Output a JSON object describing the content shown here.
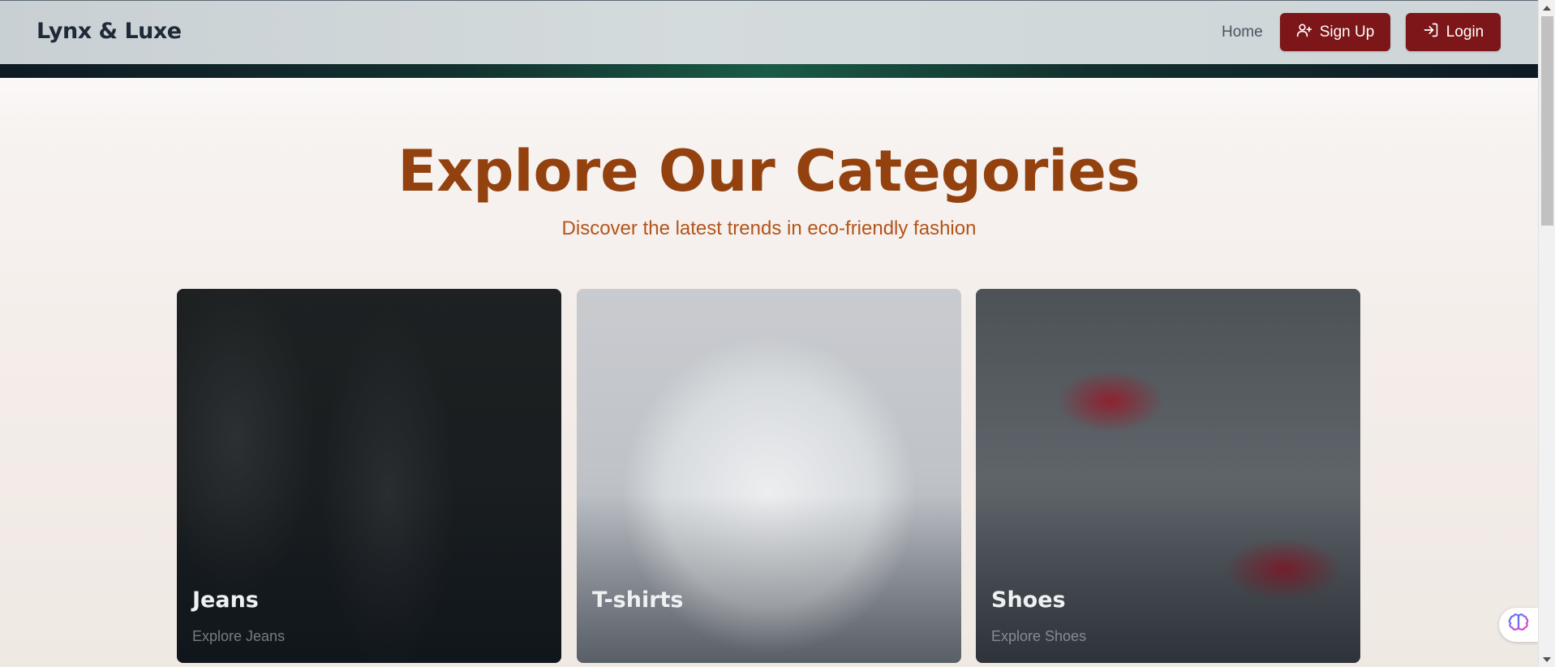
{
  "navbar": {
    "brand": "Lynx & Luxe",
    "home_label": "Home",
    "signup_label": "Sign Up",
    "login_label": "Login",
    "signup_icon": "user-plus-icon",
    "login_icon": "log-in-icon"
  },
  "hero": {
    "title": "Explore Our Categories",
    "subtitle": "Discover the latest trends in eco-friendly fashion"
  },
  "categories": [
    {
      "title": "Jeans",
      "subtitle": "Explore Jeans"
    },
    {
      "title": "T-shirts",
      "subtitle": ""
    },
    {
      "title": "Shoes",
      "subtitle": "Explore Shoes"
    }
  ],
  "colors": {
    "brand_text": "#1e2a38",
    "button_bg": "#7c1618",
    "title": "#93420f",
    "subtitle": "#b3541a"
  },
  "widget": {
    "icon": "brain-icon"
  }
}
